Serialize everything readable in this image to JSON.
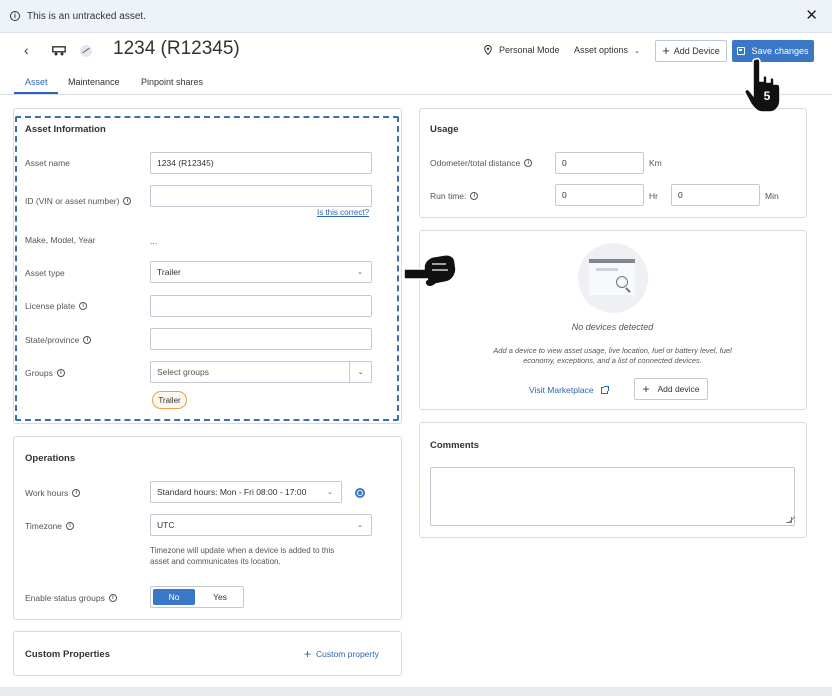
{
  "banner": {
    "text": "This is an untracked asset."
  },
  "header": {
    "title": "1234 (R12345)",
    "personal_mode": "Personal Mode",
    "asset_options": "Asset options",
    "add_device": "Add Device",
    "save_changes": "Save changes"
  },
  "tabs": [
    "Asset",
    "Maintenance",
    "Pinpoint shares"
  ],
  "asset_info": {
    "title": "Asset Information",
    "asset_name_label": "Asset name",
    "asset_name_value": "1234 (R12345)",
    "id_label": "ID (VIN or asset number)",
    "id_value": "",
    "is_correct": "Is this correct?",
    "make_label": "Make, Model, Year",
    "make_value": "...",
    "asset_type_label": "Asset type",
    "asset_type_value": "Trailer",
    "license_label": "License plate",
    "state_label": "State/province",
    "groups_label": "Groups",
    "groups_placeholder": "Select groups",
    "groups_chip": "Trailer"
  },
  "operations": {
    "title": "Operations",
    "work_hours_label": "Work hours",
    "work_hours_value": "Standard hours: Mon - Fri 08:00 - 17:00",
    "timezone_label": "Timezone",
    "timezone_value": "UTC",
    "timezone_note_1": "Timezone will update when a device is added to this",
    "timezone_note_2": "asset and communicates its location.",
    "status_groups_label": "Enable status groups",
    "toggle_no": "No",
    "toggle_yes": "Yes"
  },
  "custom_properties": {
    "title": "Custom Properties",
    "add_label": "Custom property"
  },
  "usage": {
    "title": "Usage",
    "odometer_label": "Odometer/total distance",
    "odometer_value": "0",
    "odometer_unit": "Km",
    "runtime_label": "Run time:",
    "runtime_hr_value": "0",
    "runtime_hr_unit": "Hr",
    "runtime_min_value": "0",
    "runtime_min_unit": "Min"
  },
  "devices": {
    "empty_title": "No devices detected",
    "empty_desc_1": "Add a device to view asset usage, live location, fuel or battery level, fuel",
    "empty_desc_2": "economy, exceptions, and a list of connected devices.",
    "visit_marketplace": "Visit Marketplace",
    "add_device": "Add device"
  },
  "comments": {
    "title": "Comments"
  },
  "cursor_badge": "5",
  "colors": {
    "accent": "#3a77c7",
    "chip_border": "#e8a04c",
    "dashed": "#3f6db0"
  }
}
